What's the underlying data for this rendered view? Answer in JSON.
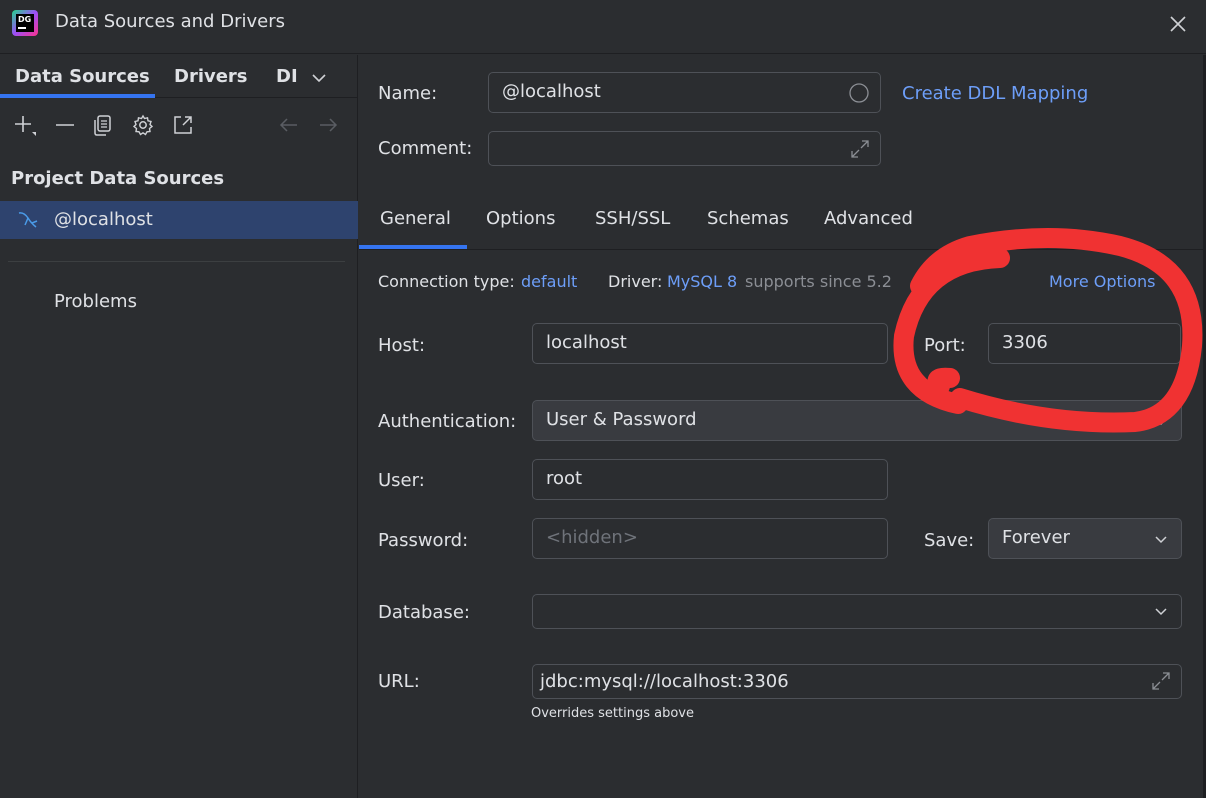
{
  "window": {
    "title": "Data Sources and Drivers",
    "app_icon_text": "DG"
  },
  "left": {
    "tabs": [
      "Data Sources",
      "Drivers",
      "DI"
    ],
    "section_title": "Project Data Sources",
    "data_source": "@localhost",
    "problems": "Problems"
  },
  "right": {
    "name_label": "Name:",
    "name_value": "@localhost",
    "ddl_link": "Create DDL Mapping",
    "comment_label": "Comment:",
    "tabs": [
      "General",
      "Options",
      "SSH/SSL",
      "Schemas",
      "Advanced"
    ],
    "connection_type_label": "Connection type:",
    "connection_type_value": "default",
    "driver_label": "Driver:",
    "driver_value": "MySQL 8",
    "driver_note": "supports since 5.2",
    "more_options": "More Options",
    "host_label": "Host:",
    "host_value": "localhost",
    "port_label": "Port:",
    "port_value": "3306",
    "auth_label": "Authentication:",
    "auth_value": "User & Password",
    "user_label": "User:",
    "user_value": "root",
    "password_label": "Password:",
    "password_placeholder": "<hidden>",
    "save_label": "Save:",
    "save_value": "Forever",
    "database_label": "Database:",
    "database_value": "",
    "url_label": "URL:",
    "url_value": "jdbc:mysql://localhost:3306",
    "url_note": "Overrides settings above"
  },
  "colors": {
    "accent": "#3574f0",
    "link": "#6d9ef8",
    "selection": "#2e436e",
    "annotation": "#f03232"
  }
}
